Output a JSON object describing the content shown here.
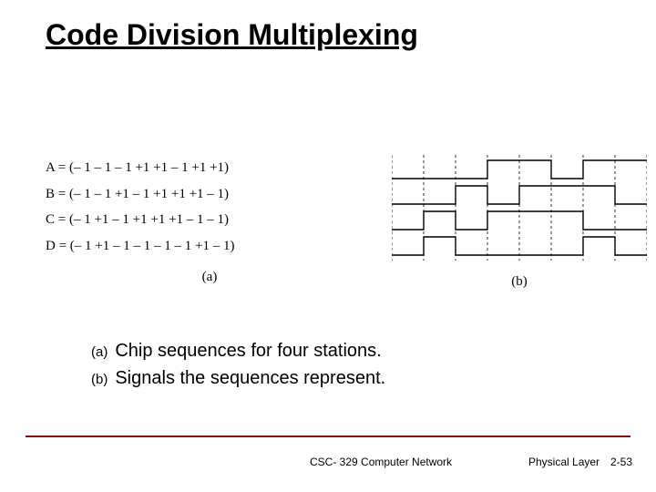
{
  "title": "Code Division Multiplexing",
  "sequences": {
    "A": "A = (– 1 – 1 – 1 +1 +1 – 1 +1 +1)",
    "B": "B = (– 1 – 1 +1 – 1 +1 +1 +1 – 1)",
    "C": "C = (– 1 +1 – 1 +1 +1 +1 – 1 – 1)",
    "D": "D = (– 1 +1 – 1 – 1 – 1 – 1 +1 – 1)"
  },
  "caption_a": "(a)",
  "caption_b": "(b)",
  "descriptions": {
    "a_label": "(a)",
    "a_text": "Chip sequences for four stations.",
    "b_label": "(b)",
    "b_text": "Signals the sequences represent."
  },
  "footer": {
    "course": "CSC- 329   Computer Network",
    "layer": "Physical Layer",
    "page": "2-53"
  },
  "chart_data": {
    "type": "step",
    "chips": 8,
    "levels": [
      -1,
      1
    ],
    "series": [
      {
        "name": "A",
        "values": [
          -1,
          -1,
          -1,
          1,
          1,
          -1,
          1,
          1
        ]
      },
      {
        "name": "B",
        "values": [
          -1,
          -1,
          1,
          -1,
          1,
          1,
          1,
          -1
        ]
      },
      {
        "name": "C",
        "values": [
          -1,
          1,
          -1,
          1,
          1,
          1,
          -1,
          -1
        ]
      },
      {
        "name": "D",
        "values": [
          -1,
          1,
          -1,
          -1,
          -1,
          -1,
          1,
          -1
        ]
      }
    ]
  }
}
